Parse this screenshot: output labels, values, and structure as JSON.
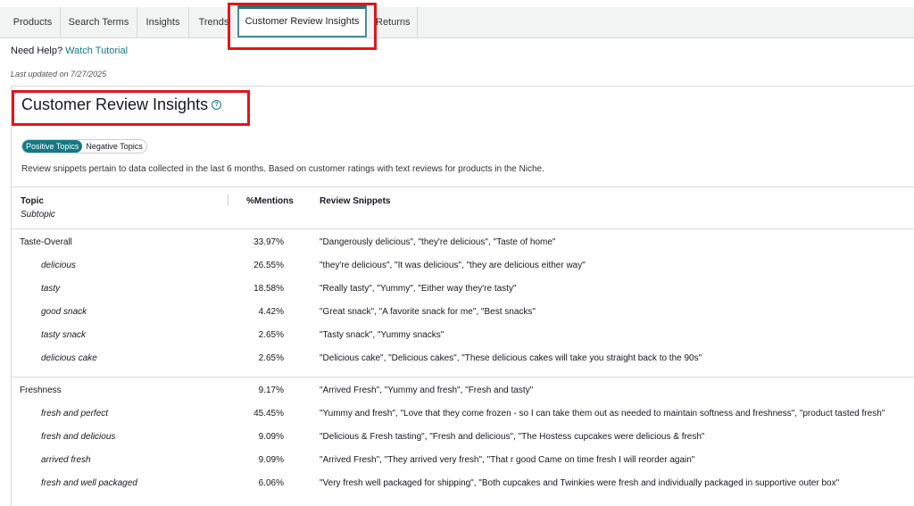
{
  "tabs": [
    {
      "label": "Products"
    },
    {
      "label": "Search Terms"
    },
    {
      "label": "Insights"
    },
    {
      "label": "Trends"
    },
    {
      "label": "Customer Review Insights",
      "active": true
    },
    {
      "label": "Returns"
    }
  ],
  "help": {
    "prefix": "Need Help?",
    "link": "Watch Tutorial"
  },
  "last_updated": "Last updated on 7/27/2025",
  "title": "Customer Review Insights",
  "help_icon": "?",
  "toggle": {
    "positive": "Positive Topics",
    "negative": "Negative Topics",
    "selected": "Positive Topics"
  },
  "description": "Review snippets pertain to data collected in the last 6 months. Based on customer ratings with text reviews for products in the Niche.",
  "table": {
    "headers": {
      "topic": "Topic",
      "subtopic": "Subtopic",
      "mentions": "%Mentions",
      "snippets": "Review Snippets"
    },
    "groups": [
      {
        "rows": [
          {
            "topic": "Taste-Overall",
            "mentions": "33.97%",
            "snippets": "\"Dangerously delicious\", \"they're delicious\", \"Taste of home\""
          },
          {
            "topic": "delicious",
            "mentions": "26.55%",
            "snippets": "\"they're delicious\", \"It was delicious\", \"they are delicious either way\""
          },
          {
            "topic": "tasty",
            "mentions": "18.58%",
            "snippets": "\"Really tasty\", \"Yummy\", \"Either way they're tasty\""
          },
          {
            "topic": "good snack",
            "mentions": "4.42%",
            "snippets": "\"Great snack\", \"A favorite snack for me\", \"Best snacks\""
          },
          {
            "topic": "tasty snack",
            "mentions": "2.65%",
            "snippets": "\"Tasty snack\", \"Yummy snacks\""
          },
          {
            "topic": "delicious cake",
            "mentions": "2.65%",
            "snippets": "\"Delicious cake\", \"Delicious cakes\", \"These delicious cakes will take you straight back to the 90s\""
          }
        ]
      },
      {
        "rows": [
          {
            "topic": "Freshness",
            "mentions": "9.17%",
            "snippets": "\"Arrived Fresh\", \"Yummy and fresh\", \"Fresh and tasty\""
          },
          {
            "topic": "fresh and perfect",
            "mentions": "45.45%",
            "snippets": "\"Yummy and fresh\", \"Love that they come frozen - so I can take them out as needed to maintain softness and freshness\", \"product tasted fresh\""
          },
          {
            "topic": "fresh and delicious",
            "mentions": "9.09%",
            "snippets": "\"Delicious & Fresh tasting\", \"Fresh and delicious\", \"The Hostess cupcakes were delicious & fresh\""
          },
          {
            "topic": "arrived fresh",
            "mentions": "9.09%",
            "snippets": "\"Arrived Fresh\", \"They arrived very fresh\", \"That r good Came on time fresh I will reorder again\""
          },
          {
            "topic": "fresh and well packaged",
            "mentions": "6.06%",
            "snippets": "\"Very fresh well packaged for shipping\", \"Both cupcakes and Twinkies were fresh and individually packaged in supportive outer box\""
          }
        ]
      }
    ]
  }
}
